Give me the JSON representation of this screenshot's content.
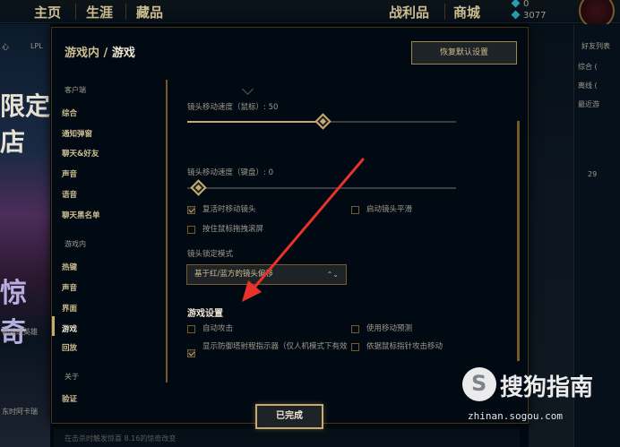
{
  "topnav": {
    "home": "主页",
    "career": "生涯",
    "collection": "藏品",
    "loot": "战利品",
    "store": "商城",
    "be": "0",
    "rp": "3077",
    "level": "29"
  },
  "background": {
    "left_small_1": "心",
    "left_small_2": "LPL",
    "left_big": "限定店",
    "left_big_2": "惊奇",
    "left_label_1": "都超级英雄",
    "left_label_2": "东时阿卡瑞",
    "bottom_text": "在击杀时触发惊喜 8.16的惊奇改变",
    "friends_header": "好友列表",
    "friends_rows": [
      "综合 (",
      "离线 (",
      "最近游"
    ]
  },
  "modal": {
    "breadcrumb_parent": "游戏内",
    "breadcrumb_sep": "/",
    "breadcrumb_current": "游戏",
    "restore_label": "恢复默认设置",
    "done_label": "已完成"
  },
  "sidebar": {
    "group_client": "客户端",
    "client_items": [
      "综合",
      "通知弹窗",
      "聊天&好友",
      "声音",
      "语音",
      "聊天黑名单"
    ],
    "group_ingame": "游戏内",
    "ingame_items": [
      "热键",
      "声音",
      "界面",
      "游戏",
      "回放"
    ],
    "group_about": "关于",
    "about_items": [
      "验证"
    ]
  },
  "settings": {
    "mouse_speed_label": "镜头移动速度（鼠标）: 50",
    "mouse_speed_value": 50,
    "keyboard_speed_label": "镜头移动速度（键盘）: 0",
    "keyboard_speed_value": 0,
    "move_on_revive": "复活时移动镜头",
    "move_on_revive_checked": true,
    "camera_smooth": "启动镜头平滑",
    "camera_smooth_checked": false,
    "drag_scroll": "按住鼠标拖拽滚屏",
    "drag_scroll_checked": false,
    "lock_mode_label": "镜头锁定模式",
    "lock_mode_value": "基于红/蓝方的镜头偏移",
    "section_title": "游戏设置",
    "auto_attack": "自动攻击",
    "auto_attack_checked": false,
    "movement_prediction": "使用移动预测",
    "movement_prediction_checked": false,
    "tower_range": "显示防御塔射程指示器（仅人机模式下有效",
    "tower_range_checked": true,
    "attack_move_cursor": "依据鼠标指针攻击移动",
    "attack_move_cursor_checked": false
  },
  "watermark": {
    "logo": "S",
    "brand": "搜狗指南",
    "url": "zhinan.sogou.com"
  },
  "colors": {
    "gold": "#c8aa6e",
    "gold_light": "#f0e6d2",
    "arrow_red": "#e8322a"
  }
}
